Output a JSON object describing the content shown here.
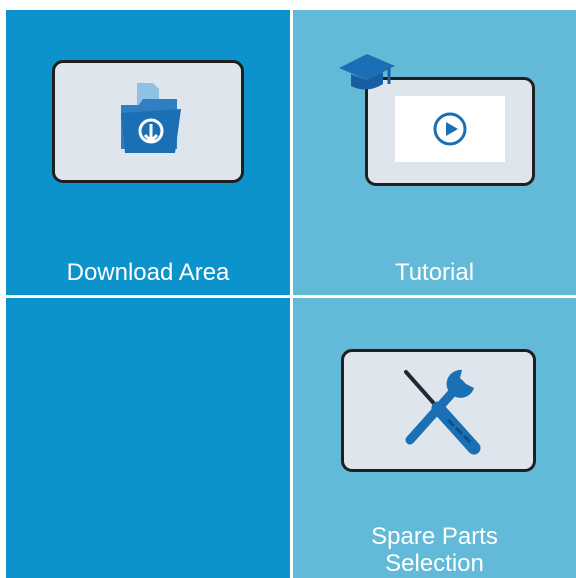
{
  "tiles": {
    "download": {
      "label": "Download Area",
      "icon": "folder-download-icon"
    },
    "tutorial": {
      "label": "Tutorial",
      "icon": "graduation-cap-icon",
      "screen_icon": "play-icon"
    },
    "spare_parts": {
      "label_line1": "Spare Parts",
      "label_line2": "Selection",
      "icon": "wrench-screwdriver-icon"
    }
  },
  "colors": {
    "tile_dark": "#0d93cb",
    "tile_light": "#62bad8",
    "icon_blue": "#1b6fb5",
    "screen_fill": "#dfe5ec",
    "screen_border": "#1f1f1f",
    "label_text": "#ffffff"
  }
}
